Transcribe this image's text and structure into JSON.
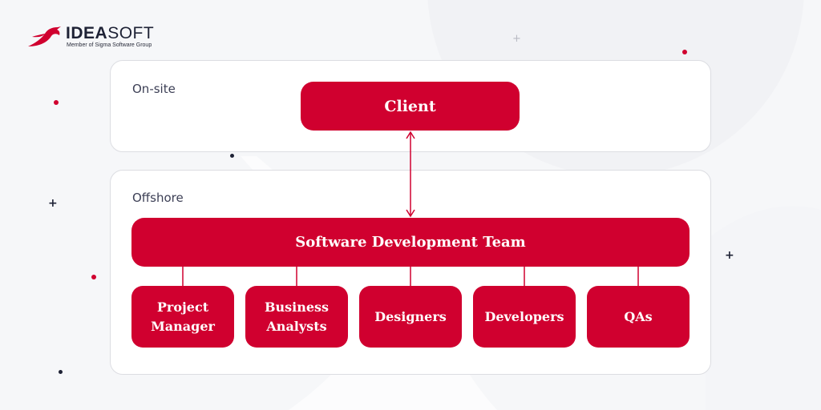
{
  "brand": {
    "name_bold": "IDEA",
    "name_light": "SOFT",
    "tagline": "Member of Sigma Software Group",
    "logo_icon": "swallow-bird-icon"
  },
  "colors": {
    "accent": "#d0002f",
    "text_dark": "#1e2235",
    "label_text": "#3c3f55",
    "panel_border": "#dcdde2",
    "background": "#f6f7f9"
  },
  "diagram": {
    "zones": [
      {
        "id": "onsite",
        "label": "On-site"
      },
      {
        "id": "offshore",
        "label": "Offshore"
      }
    ],
    "client": {
      "label": "Client"
    },
    "team": {
      "label": "Software Development Team"
    },
    "roles": [
      {
        "label": "Project Manager"
      },
      {
        "label": "Business Analysts"
      },
      {
        "label": "Designers"
      },
      {
        "label": "Developers"
      },
      {
        "label": "QAs"
      }
    ],
    "edges": [
      {
        "from": "Client",
        "to": "Software Development Team",
        "type": "bidirectional-arrow"
      },
      {
        "from": "Software Development Team",
        "to": "Project Manager",
        "type": "line"
      },
      {
        "from": "Software Development Team",
        "to": "Business Analysts",
        "type": "line"
      },
      {
        "from": "Software Development Team",
        "to": "Designers",
        "type": "line"
      },
      {
        "from": "Software Development Team",
        "to": "Developers",
        "type": "line"
      },
      {
        "from": "Software Development Team",
        "to": "QAs",
        "type": "line"
      }
    ]
  },
  "decorations": {
    "plus_icon": "+"
  }
}
